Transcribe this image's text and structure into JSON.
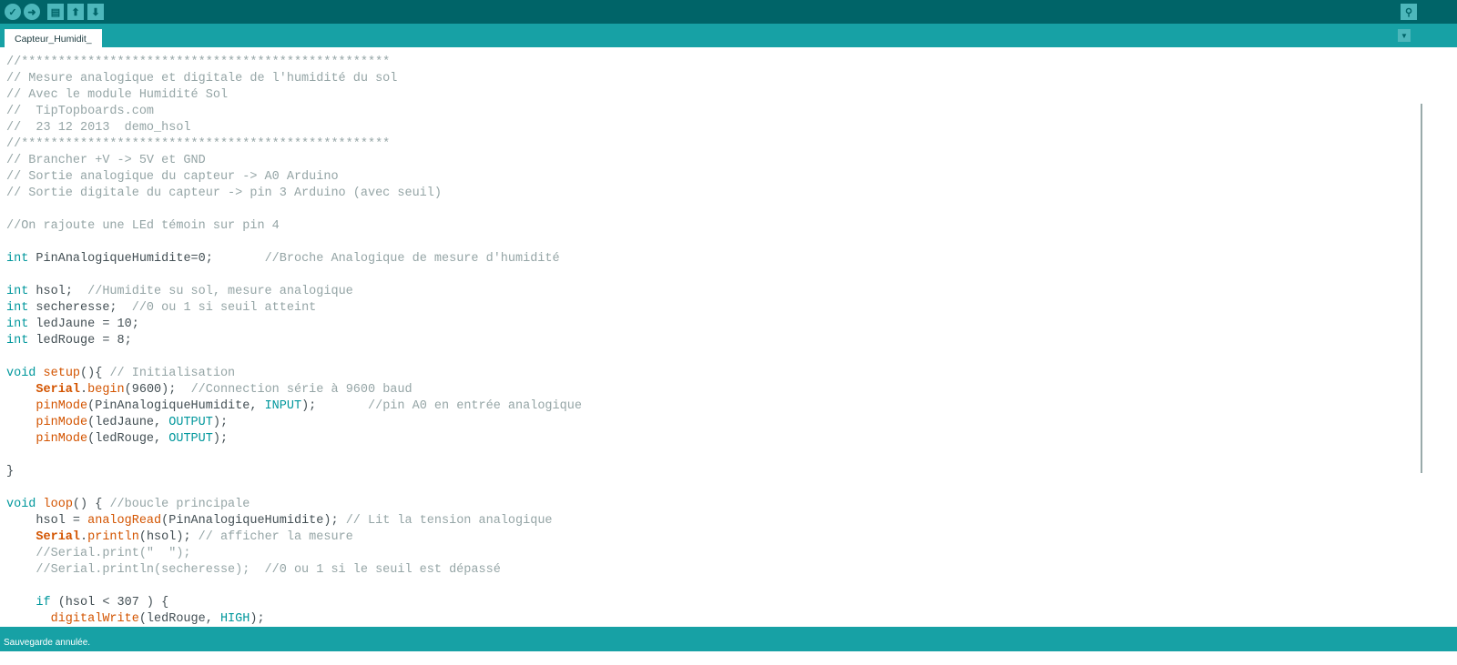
{
  "toolbar": {
    "buttons": [
      {
        "name": "verify-button",
        "icon": "check-icon",
        "glyph": "✓"
      },
      {
        "name": "upload-button",
        "icon": "arrow-right-icon",
        "glyph": "➜"
      },
      {
        "name": "new-button",
        "icon": "file-icon",
        "glyph": "▤"
      },
      {
        "name": "open-button",
        "icon": "arrow-up-icon",
        "glyph": "⬆"
      },
      {
        "name": "save-button",
        "icon": "arrow-down-icon",
        "glyph": "⬇"
      }
    ],
    "serial_monitor_icon": "magnifier-icon",
    "serial_glyph": "⚲"
  },
  "tab": {
    "label": "Capteur_Humidit_",
    "menu_glyph": "▼"
  },
  "colors": {
    "toolbar": "#006468",
    "tabbar": "#17a1a5",
    "keyword": "#00979c",
    "function": "#d35400",
    "comment": "#95a5a6"
  },
  "code": [
    [
      [
        "//**************************************************",
        "cm"
      ]
    ],
    [
      [
        "// Mesure analogique et digitale de l'humidité du sol",
        "cm"
      ]
    ],
    [
      [
        "// Avec le module Humidité Sol",
        "cm"
      ]
    ],
    [
      [
        "//  TipTopboards.com",
        "cm"
      ]
    ],
    [
      [
        "//  23 12 2013  demo_hsol",
        "cm"
      ]
    ],
    [
      [
        "//**************************************************",
        "cm"
      ]
    ],
    [
      [
        "// Brancher +V -> 5V et GND",
        "cm"
      ]
    ],
    [
      [
        "// Sortie analogique du capteur -> A0 Arduino",
        "cm"
      ]
    ],
    [
      [
        "// Sortie digitale du capteur -> pin 3 Arduino (avec seuil)",
        "cm"
      ]
    ],
    [],
    [
      [
        "//On rajoute une LEd témoin sur pin 4",
        "cm"
      ]
    ],
    [],
    [
      [
        "int",
        "kw"
      ],
      [
        " PinAnalogiqueHumidite=0;       ",
        ""
      ],
      [
        "//Broche Analogique de mesure d'humidité",
        "cm"
      ]
    ],
    [],
    [
      [
        "int",
        "kw"
      ],
      [
        " hsol;  ",
        ""
      ],
      [
        "//Humidite su sol, mesure analogique",
        "cm"
      ]
    ],
    [
      [
        "int",
        "kw"
      ],
      [
        " secheresse;  ",
        ""
      ],
      [
        "//0 ou 1 si seuil atteint",
        "cm"
      ]
    ],
    [
      [
        "int",
        "kw"
      ],
      [
        " ledJaune = 10;",
        ""
      ]
    ],
    [
      [
        "int",
        "kw"
      ],
      [
        " ledRouge = 8;",
        ""
      ]
    ],
    [],
    [
      [
        "void",
        "kw"
      ],
      [
        " ",
        ""
      ],
      [
        "setup",
        "fn"
      ],
      [
        "(){ ",
        ""
      ],
      [
        "// Initialisation",
        "cm"
      ]
    ],
    [
      [
        "    ",
        ""
      ],
      [
        "Serial",
        "obj"
      ],
      [
        ".",
        ""
      ],
      [
        "begin",
        "fn"
      ],
      [
        "(9600);  ",
        ""
      ],
      [
        "//Connection série à 9600 baud",
        "cm"
      ]
    ],
    [
      [
        "    ",
        ""
      ],
      [
        "pinMode",
        "fn"
      ],
      [
        "(PinAnalogiqueHumidite, ",
        ""
      ],
      [
        "INPUT",
        "cst"
      ],
      [
        ");       ",
        ""
      ],
      [
        "//pin A0 en entrée analogique",
        "cm"
      ]
    ],
    [
      [
        "    ",
        ""
      ],
      [
        "pinMode",
        "fn"
      ],
      [
        "(ledJaune, ",
        ""
      ],
      [
        "OUTPUT",
        "cst"
      ],
      [
        ");",
        ""
      ]
    ],
    [
      [
        "    ",
        ""
      ],
      [
        "pinMode",
        "fn"
      ],
      [
        "(ledRouge, ",
        ""
      ],
      [
        "OUTPUT",
        "cst"
      ],
      [
        ");",
        ""
      ]
    ],
    [],
    [
      [
        "}",
        ""
      ]
    ],
    [],
    [
      [
        "void",
        "kw"
      ],
      [
        " ",
        ""
      ],
      [
        "loop",
        "fn"
      ],
      [
        "() { ",
        ""
      ],
      [
        "//boucle principale",
        "cm"
      ]
    ],
    [
      [
        "    hsol = ",
        ""
      ],
      [
        "analogRead",
        "fn"
      ],
      [
        "(PinAnalogiqueHumidite); ",
        ""
      ],
      [
        "// Lit la tension analogique",
        "cm"
      ]
    ],
    [
      [
        "    ",
        ""
      ],
      [
        "Serial",
        "obj"
      ],
      [
        ".",
        ""
      ],
      [
        "println",
        "fn"
      ],
      [
        "(hsol); ",
        ""
      ],
      [
        "// afficher la mesure",
        "cm"
      ]
    ],
    [
      [
        "    ",
        ""
      ],
      [
        "//Serial.print(\"  \");",
        "cm"
      ]
    ],
    [
      [
        "    ",
        ""
      ],
      [
        "//Serial.println(secheresse);  //0 ou 1 si le seuil est dépassé",
        "cm"
      ]
    ],
    [],
    [
      [
        "    ",
        ""
      ],
      [
        "if",
        "kw"
      ],
      [
        " (hsol < 307 ) {",
        ""
      ]
    ],
    [
      [
        "      ",
        ""
      ],
      [
        "digitalWrite",
        "fn"
      ],
      [
        "(ledRouge, ",
        ""
      ],
      [
        "HIGH",
        "cst"
      ],
      [
        ");",
        ""
      ]
    ]
  ],
  "status": {
    "message": "Sauvegarde annulée."
  }
}
